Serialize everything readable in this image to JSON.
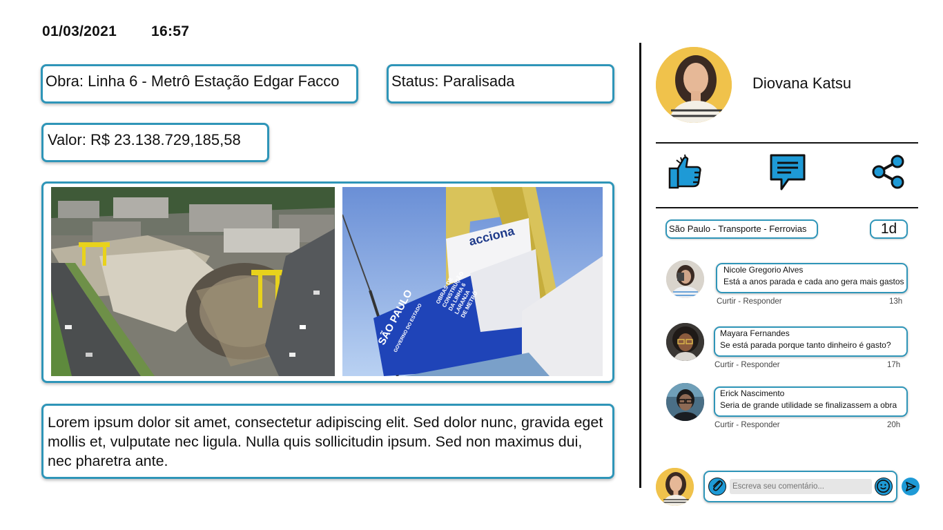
{
  "header": {
    "date": "01/03/2021",
    "time": "16:57"
  },
  "fields": {
    "obra": "Obra: Linha 6 - Metrô Estação Edgar Facco",
    "status": "Status: Paralisada",
    "valor": "Valor: R$ 23.138.729,185,58"
  },
  "photo2": {
    "brand": "acciona",
    "sp_logo": "SÃO PAULO",
    "sp_sub": "GOVERNO DO ESTADO",
    "banner_lines": [
      "OBRAS DE",
      "CONSTRUÇÃO",
      "DA LINHA 6",
      "LARANJA",
      "DE METRÔ"
    ]
  },
  "description": "Lorem ipsum dolor sit amet, consectetur adipiscing elit. Sed dolor nunc, gravida eget mollis et, vulputate nec ligula. Nulla quis sollicitudin ipsum. Sed non maximus dui, nec pharetra ante.",
  "profile": {
    "name": "Diovana Katsu"
  },
  "actions": {
    "like": "thumbs-up-icon",
    "comment": "comment-icon",
    "share": "share-icon"
  },
  "tag": {
    "category": "São Paulo - Transporte - Ferrovias",
    "age": "1d"
  },
  "comments": [
    {
      "name": "Nicole Gregorio Alves",
      "text": "Está a anos parada e cada ano gera mais gastos",
      "actions": "Curtir - Responder",
      "time": "13h"
    },
    {
      "name": "Mayara Fernandes",
      "text": "Se está parada porque tanto dinheiro é gasto?",
      "actions": "Curtir - Responder",
      "time": "17h"
    },
    {
      "name": "Erick Nascimento",
      "text": "Seria de grande utilidade se finalizassem a obra",
      "actions": "Curtir - Responder",
      "time": "20h"
    }
  ],
  "composer": {
    "placeholder": "Escreva seu comentário..."
  },
  "colors": {
    "accent": "#2e95b8",
    "icon_blue": "#1e9ad6"
  }
}
